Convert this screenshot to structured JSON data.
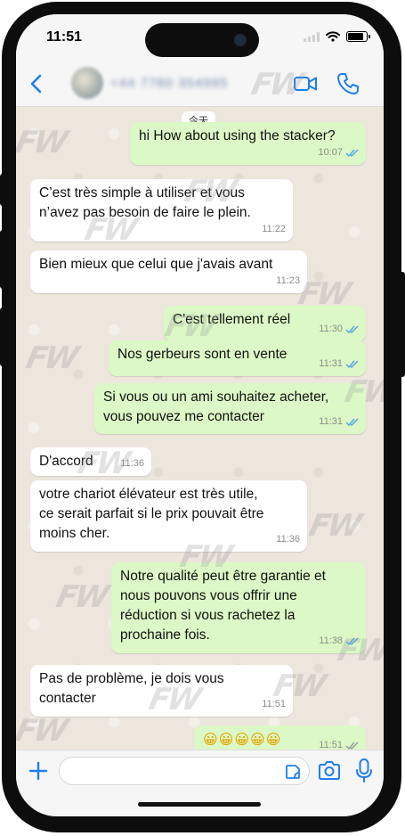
{
  "status_bar": {
    "time": "11:51"
  },
  "header": {
    "contact_name": "+44 7780 354995"
  },
  "chat": {
    "date_label": "今天",
    "messages": [
      {
        "dir": "out",
        "text": "hi  How about using the stacker?",
        "time": "10:07",
        "read": true
      },
      {
        "dir": "in",
        "text": "C’est très simple à utiliser et vous\nn’avez pas besoin de faire le plein.",
        "time": "11:22"
      },
      {
        "dir": "in",
        "text": "Bien mieux que celui que j'avais avant",
        "time": "11:23"
      },
      {
        "dir": "out",
        "text": "C'est tellement réel",
        "time": "11:30",
        "read": true
      },
      {
        "dir": "out",
        "text": "Nos gerbeurs sont en vente",
        "time": "11:31",
        "read": true
      },
      {
        "dir": "out",
        "text": "Si vous ou un ami souhaitez acheter,\nvous pouvez me contacter",
        "time": "11:31",
        "read": true
      },
      {
        "dir": "in",
        "text": "D'accord",
        "time": "11:36"
      },
      {
        "dir": "in",
        "text": "votre chariot élévateur est très utile,\nce serait parfait si le prix pouvait être\nmoins cher.",
        "time": "11:36"
      },
      {
        "dir": "out",
        "text": "Notre qualité peut être garantie et\nnous pouvons vous offrir une\nréduction si vous rachetez la\nprochaine fois.",
        "time": "11:38",
        "read": true
      },
      {
        "dir": "in",
        "text": "Pas de problème, je dois vous\ncontacter",
        "time": "11:51"
      },
      {
        "dir": "out",
        "text": "😀😀😀😀😀",
        "time": "11:51",
        "read": false
      }
    ]
  },
  "watermark": {
    "text": "FW"
  },
  "colors": {
    "outgoing_bubble": "#dcf8c6",
    "incoming_bubble": "#ffffff",
    "accent": "#1f7ef0",
    "read_ticks": "#4fa6e8"
  }
}
